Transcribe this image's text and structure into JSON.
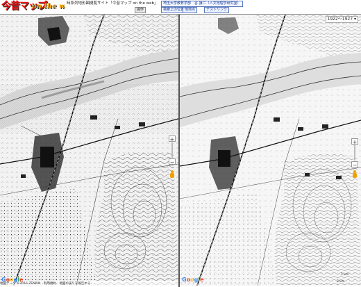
{
  "header": {
    "logo_main": "今昔マップ",
    "logo_sub": "on the web",
    "site_title": "時系列地形図閲覧サイト「今昔マップ on the web」",
    "nav_button": "操作",
    "credit": "埼玉大学教育学部　谷 謙二（人文地理学研究室）",
    "tools": [
      "検索上の位置",
      "他地点",
      "テストリンク"
    ]
  },
  "left_pane": {
    "footer": "地図データ ©2016 ZENRIN　利用規約　地図の誤りを報告する"
  },
  "right_pane": {
    "year": "1922～1927",
    "scale_labels": [
      "2 km",
      "1 km"
    ]
  },
  "google": "Google",
  "icons": {
    "zoom_in": "+",
    "zoom_out": "−",
    "pegman": "pegman-icon",
    "year_toggle": "chevron-down-icon"
  },
  "colors": {
    "map_paper": "#f4f4f4",
    "map_ink": "#222222",
    "logo_red": "#ee1111",
    "logo_yellow": "#f2a100",
    "credit_blue": "#1c3f98"
  }
}
